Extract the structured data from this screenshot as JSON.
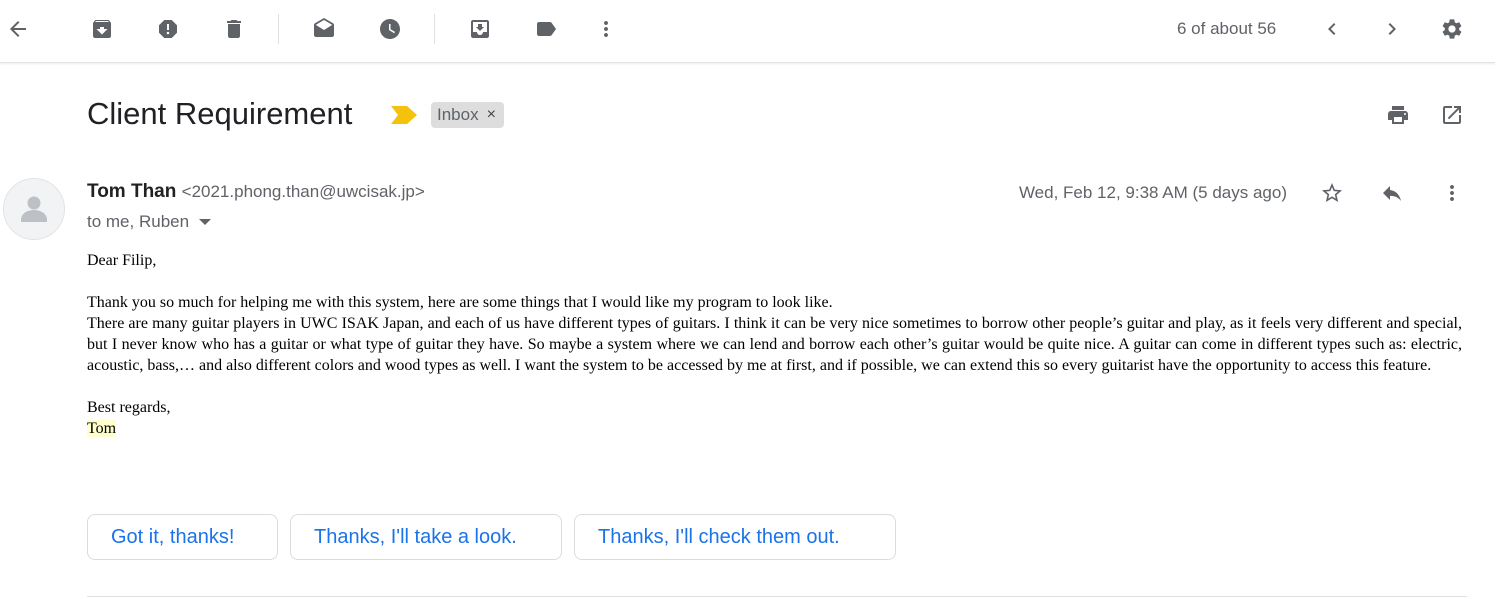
{
  "toolbar": {
    "icons": [
      "back-arrow-icon",
      "archive-icon",
      "report-spam-icon",
      "delete-icon",
      "mark-unread-icon",
      "snooze-icon",
      "move-to-icon",
      "label-icon",
      "more-vert-icon"
    ],
    "pager_text": "6 of about 56"
  },
  "email": {
    "subject": "Client Requirement",
    "label": "Inbox",
    "label_close": "×",
    "sender_name": "Tom Than",
    "sender_email": "<2021.phong.than@uwcisak.jp>",
    "recipients": "to me, Ruben",
    "date": "Wed, Feb 12, 9:38 AM (5 days ago)",
    "greeting": "Dear Filip,",
    "paragraph1": "Thank you so much for helping me with this system, here are some things that I would like my program to look like.",
    "paragraph2": "There are many guitar players in UWC ISAK Japan, and each of us have different types of guitars. I think it can be very nice sometimes to borrow other people’s guitar and play, as it feels very different and special, but I never know who has a guitar or what type of guitar they have. So maybe a system where we can lend and borrow each other’s guitar would be quite nice. A guitar can come in different types such as: electric, acoustic, bass,… and also different colors and wood types as well. I want the system to be accessed by me at first, and if possible, we can extend this so every guitarist have the opportunity to access this feature.",
    "closing": "Best regards,",
    "signature": "Tom"
  },
  "smart_replies": [
    "Got it, thanks!",
    "Thanks, I'll take a look.",
    "Thanks, I'll check them out."
  ],
  "colors": {
    "accent": "#1a73e8",
    "importance_marker": "#f4c20d",
    "icon": "#5f6368"
  }
}
